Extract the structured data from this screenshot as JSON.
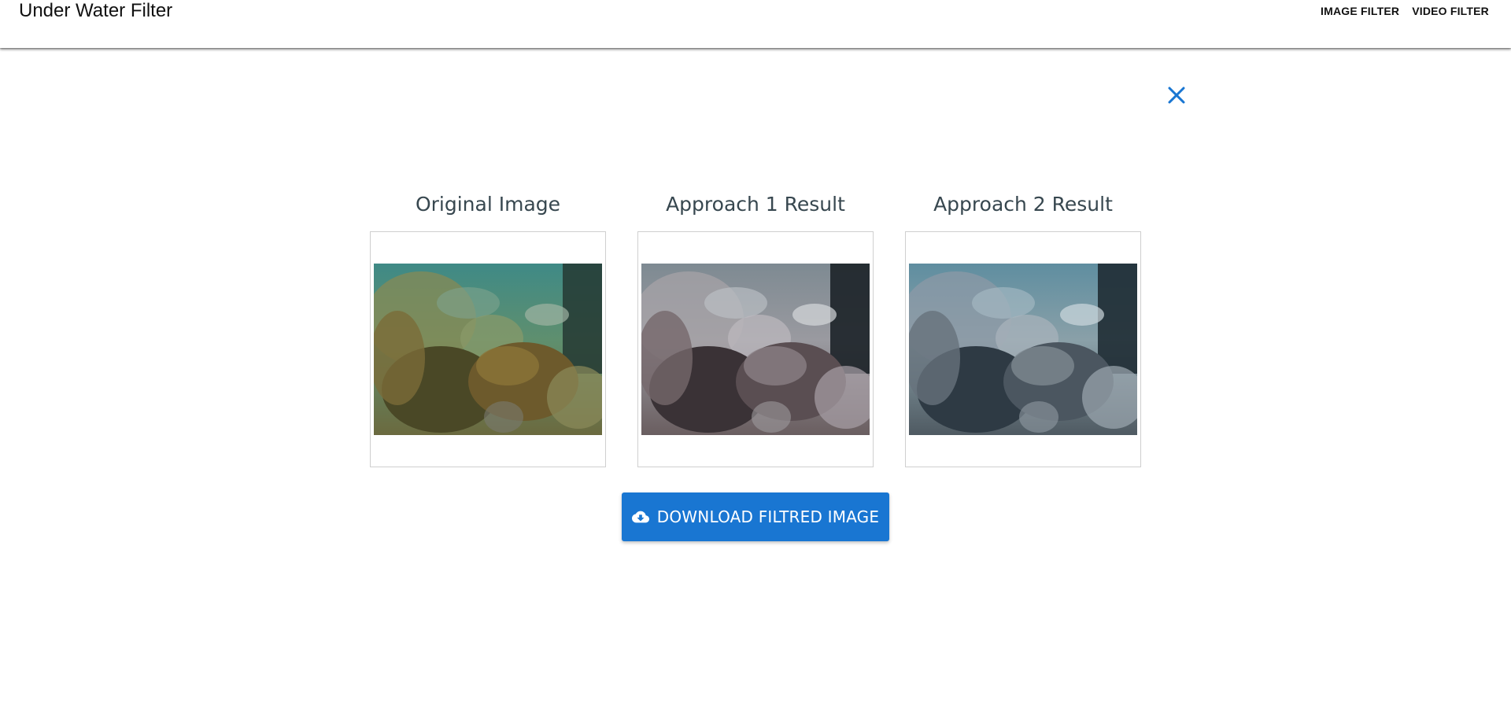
{
  "app": {
    "title": "Under Water Filter"
  },
  "nav": {
    "items": [
      {
        "label": "IMAGE FILTER"
      },
      {
        "label": "VIDEO FILTER"
      }
    ]
  },
  "dialog": {
    "close_icon": "close-icon",
    "panels": [
      {
        "title": "Original Image"
      },
      {
        "title": "Approach 1 Result"
      },
      {
        "title": "Approach 2 Result"
      }
    ],
    "download_label": "DOWNLOAD FILTRED IMAGE",
    "download_icon": "cloud-download-icon"
  },
  "colors": {
    "accent": "#1976d2",
    "title_text": "#37474f",
    "panel_border": "#cfcfcf"
  }
}
